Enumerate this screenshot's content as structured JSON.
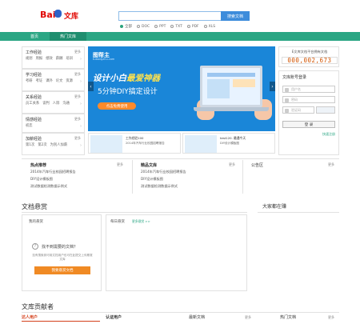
{
  "logo": {
    "bai": "Bai",
    "wenku": "文库"
  },
  "search": {
    "placeholder": "",
    "button": "搜索文档"
  },
  "doc_types": [
    "全部",
    "DOC",
    "PPT",
    "TXT",
    "PDF",
    "XLS"
  ],
  "nav": {
    "home": "首页",
    "hot": "热门文库"
  },
  "categories": [
    {
      "title": "工作经验",
      "more": "更多",
      "links": [
        "规划",
        "周报",
        "绩效",
        "薪酬",
        "培训"
      ]
    },
    {
      "title": "学习经验",
      "more": "更多",
      "links": [
        "考研",
        "考证",
        "课外",
        "论文",
        "资源"
      ]
    },
    {
      "title": "关系经验",
      "more": "更多",
      "links": [
        "员工关系",
        "谈判",
        "人际",
        "沟通"
      ]
    },
    {
      "title": "情感经验",
      "more": "更多",
      "links": [
        "初恋"
      ]
    },
    {
      "title": "加薪经验",
      "more": "更多",
      "links": [
        "第1次",
        "第2次",
        "为别人加薪"
      ]
    }
  ],
  "banner": {
    "brand": "图帮主",
    "brand_sub": "tubangzhu.com",
    "headline_a": "设计小白",
    "headline_b": "最爱神器",
    "subline": "5分钟DIY搞定设计",
    "cta": "点击免费使用",
    "prev": "‹",
    "next": "›"
  },
  "thumbs": [
    {
      "title": "工作经验100",
      "sub": "2014年汽车行业校园招聘报告"
    },
    {
      "title": "test120.  最遇今天",
      "sub": "DIY设计模板图"
    }
  ],
  "counter": {
    "title": "E文库文档平台拥有文档",
    "value": "000,002,673"
  },
  "login": {
    "title": "文库账号登录",
    "username_ph": "用户名",
    "password_ph": "密码",
    "captcha_ph": "验证码",
    "button": "登 录",
    "register": "快速注册"
  },
  "hot_docs": {
    "title": "热点推荐",
    "more": "更多",
    "items": [
      "2014年汽车行业校园招聘报告",
      "DIY设计模板图",
      "测试数据检测数据示例式"
    ]
  },
  "featured_docs": {
    "title": "精品文库",
    "more": "更多",
    "items": [
      "2014年汽车行业校园招聘报告",
      "DIY设计模板图",
      "测试数据检测数据示例式"
    ]
  },
  "announcement": {
    "title": "公告区",
    "more": "更多"
  },
  "doc_help": {
    "title": "文档悬赏",
    "my_reward": "我的悬赏",
    "daily": "每日悬赏",
    "daily_more": "更多悬赏 >>",
    "empty_title": "找不到需要的文档？",
    "empty_desc": "没有搜索到可用文档用户也可在此提交上传悬赏文库",
    "button": "我要悬赏文档"
  },
  "everyone_looking": {
    "title": "大家都在赚"
  },
  "contributors": {
    "title": "文库贡献者",
    "talent": "达人用户",
    "certified": "认证用户",
    "latest": "最新文档",
    "hot": "热门文档",
    "more": "更多"
  }
}
